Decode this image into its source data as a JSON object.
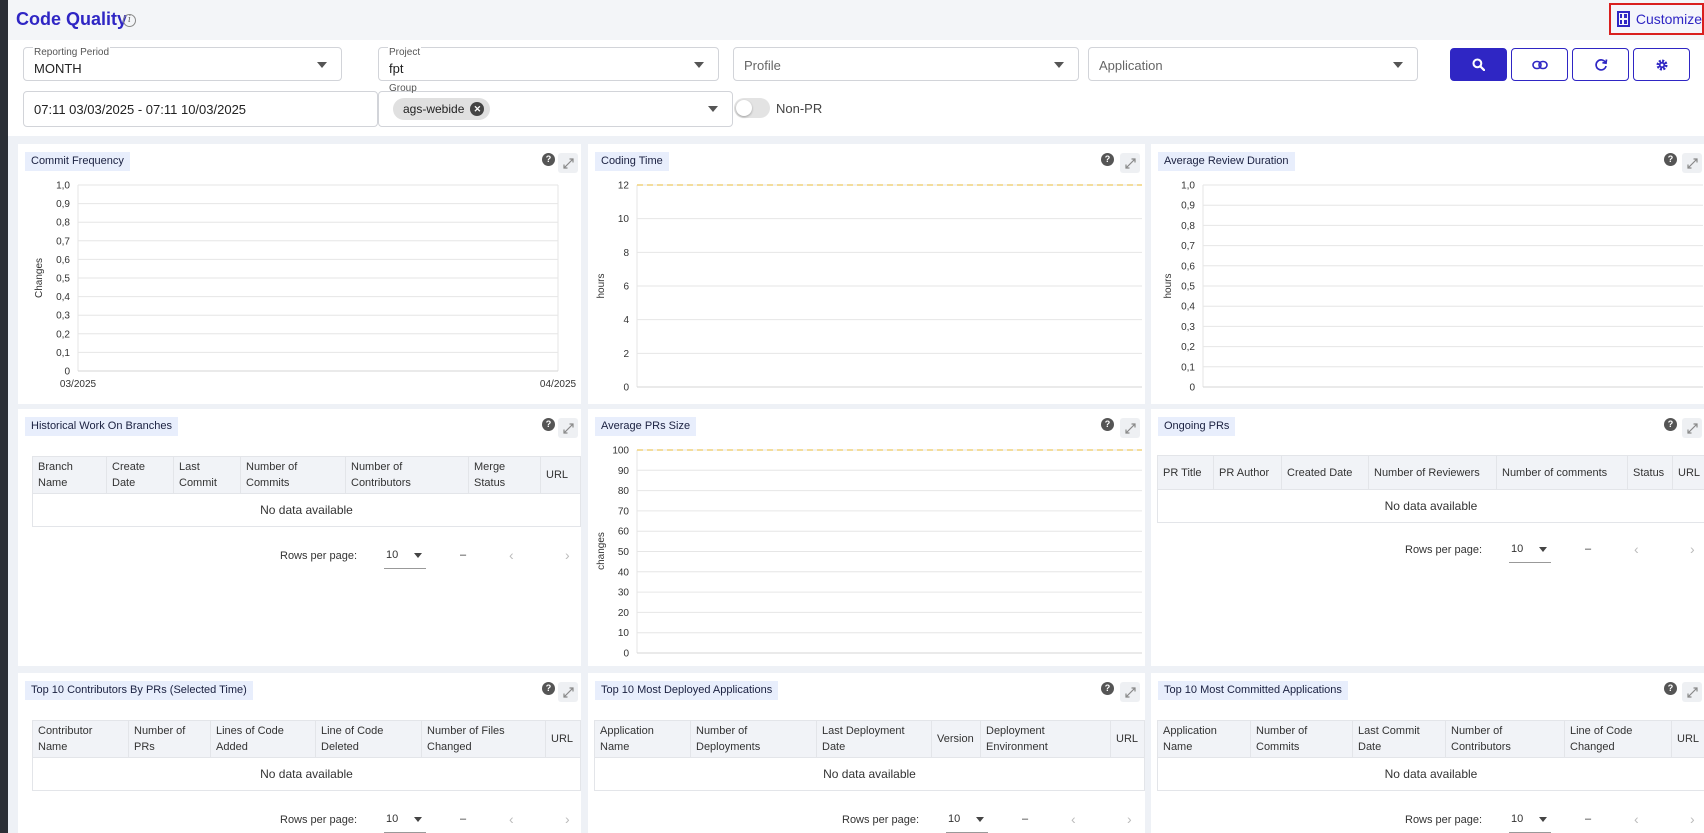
{
  "header": {
    "title": "Code Quality",
    "info_icon": "info-icon",
    "customize_label": "Customize",
    "customize_icon": "dashboard-icon",
    "accent_color": "#2f26c4",
    "highlight_color": "#d9201f"
  },
  "filters": {
    "reporting_period": {
      "label": "Reporting Period",
      "value": "MONTH"
    },
    "project": {
      "label": "Project",
      "value": "fpt"
    },
    "profile": {
      "placeholder": "Profile"
    },
    "application": {
      "placeholder": "Application"
    },
    "date_range": "07:11 03/03/2025 - 07:11 10/03/2025",
    "group": {
      "label": "Group",
      "chip": "ags-webide"
    },
    "non_pr": {
      "label": "Non-PR",
      "checked": false
    },
    "buttons": [
      "search-icon",
      "link-icon",
      "refresh-icon",
      "gear-icon"
    ]
  },
  "widgets": {
    "commit_frequency": {
      "title": "Commit Frequency"
    },
    "coding_time": {
      "title": "Coding Time"
    },
    "avg_review": {
      "title": "Average Review Duration"
    },
    "historical_work": {
      "title": "Historical Work On Branches",
      "columns": [
        "Branch Name",
        "Create Date",
        "Last Commit",
        "Number of Commits",
        "Number of Contributors",
        "Merge Status",
        "URL"
      ],
      "empty": "No data available"
    },
    "avg_pr_size": {
      "title": "Average PRs Size"
    },
    "ongoing_prs": {
      "title": "Ongoing PRs",
      "columns": [
        "PR Title",
        "PR Author",
        "Created Date",
        "Number of Reviewers",
        "Number of comments",
        "Status",
        "URL"
      ],
      "empty": "No data available"
    },
    "top_contributors": {
      "title": "Top 10 Contributors By PRs (Selected Time)",
      "columns": [
        "Contributor Name",
        "Number of PRs",
        "Lines of Code Added",
        "Line of Code Deleted",
        "Number of Files Changed",
        "URL"
      ],
      "empty": "No data available"
    },
    "top_deployed": {
      "title": "Top 10 Most Deployed Applications",
      "columns": [
        "Application Name",
        "Number of Deployments",
        "Last Deployment Date",
        "Version",
        "Deployment Environment",
        "URL"
      ],
      "empty": "No data available"
    },
    "top_committed": {
      "title": "Top 10 Most Committed Applications",
      "columns": [
        "Application Name",
        "Number of Commits",
        "Last Commit Date",
        "Number of Contributors",
        "Line of Code Changed",
        "URL"
      ],
      "empty": "No data available"
    }
  },
  "pagination": {
    "rows_per_page_label": "Rows per page:",
    "rows_per_page": "10",
    "range": "–",
    "prev": "‹",
    "next": "›"
  },
  "chart_data": [
    {
      "type": "line",
      "title": "Commit Frequency",
      "ylabel": "Changes",
      "xlabel": "",
      "x_ticks": [
        "03/2025",
        "04/2025"
      ],
      "y_ticks": [
        "1,0",
        "0,9",
        "0,8",
        "0,7",
        "0,6",
        "0,5",
        "0,4",
        "0,3",
        "0,2",
        "0,1",
        "0"
      ],
      "ylim": [
        0,
        1
      ],
      "grid": true,
      "series": []
    },
    {
      "type": "line",
      "title": "Coding Time",
      "ylabel": "hours",
      "xlabel": "",
      "y_ticks": [
        "12",
        "10",
        "8",
        "6",
        "4",
        "2",
        "0"
      ],
      "ylim": [
        0,
        12
      ],
      "grid": true,
      "reference_line": {
        "value": 12,
        "color": "#f0d27a",
        "style": "dashed"
      },
      "series": []
    },
    {
      "type": "line",
      "title": "Average Review Duration",
      "ylabel": "hours",
      "xlabel": "",
      "y_ticks": [
        "1,0",
        "0,9",
        "0,8",
        "0,7",
        "0,6",
        "0,5",
        "0,4",
        "0,3",
        "0,2",
        "0,1",
        "0"
      ],
      "ylim": [
        0,
        1
      ],
      "grid": true,
      "series": []
    },
    {
      "type": "line",
      "title": "Average PRs Size",
      "ylabel": "changes",
      "xlabel": "",
      "y_ticks": [
        "100",
        "90",
        "80",
        "70",
        "60",
        "50",
        "40",
        "30",
        "20",
        "10",
        "0"
      ],
      "ylim": [
        0,
        100
      ],
      "grid": true,
      "reference_line": {
        "value": 100,
        "color": "#f0d27a",
        "style": "dashed"
      },
      "series": []
    }
  ]
}
